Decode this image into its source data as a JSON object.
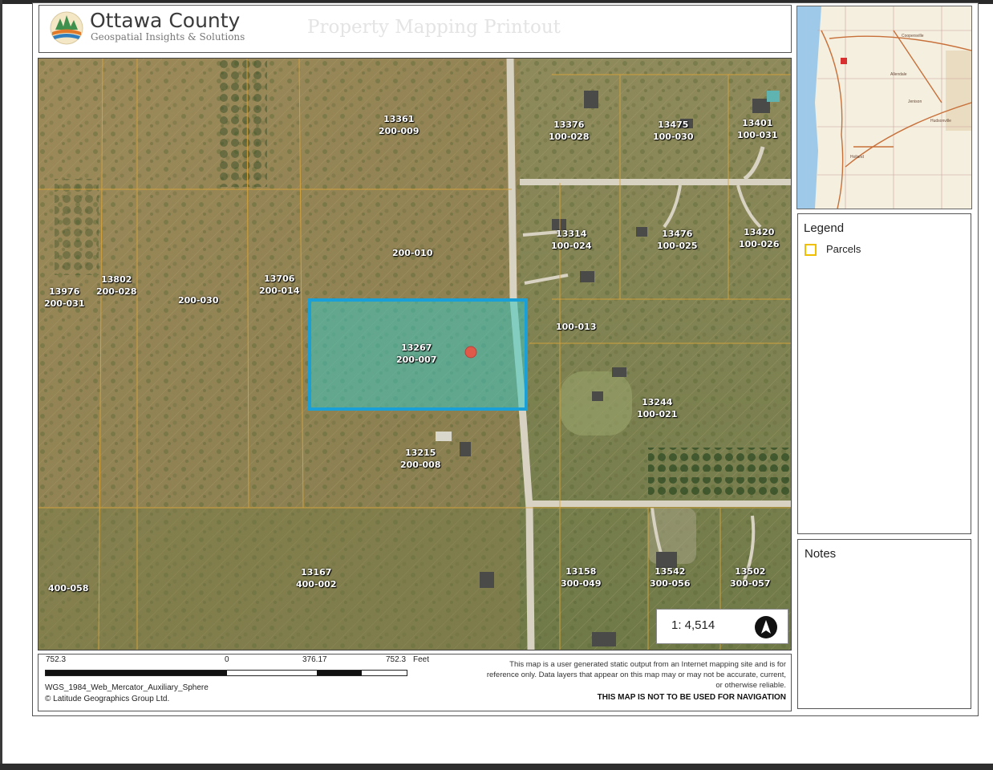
{
  "header": {
    "org_name": "Ottawa County",
    "org_tagline": "Geospatial Insights & Solutions",
    "doc_title": "Property Mapping Printout"
  },
  "map": {
    "parcels": [
      {
        "number": "13361",
        "id": "200-009"
      },
      {
        "number": "13376",
        "id": "100-028"
      },
      {
        "number": "13475",
        "id": "100-030"
      },
      {
        "number": "13401",
        "id": "100-031"
      },
      {
        "number": "",
        "id": "200-010"
      },
      {
        "number": "13314",
        "id": "100-024"
      },
      {
        "number": "13476",
        "id": "100-025"
      },
      {
        "number": "13420",
        "id": "100-026"
      },
      {
        "number": "13802",
        "id": "200-028"
      },
      {
        "number": "13706",
        "id": "200-014"
      },
      {
        "number": "13976",
        "id": "200-031"
      },
      {
        "number": "",
        "id": "200-030"
      },
      {
        "number": "",
        "id": "100-013"
      },
      {
        "number": "13267",
        "id": "200-007"
      },
      {
        "number": "13244",
        "id": "100-021"
      },
      {
        "number": "13215",
        "id": "200-008"
      },
      {
        "number": "",
        "id": "400-058"
      },
      {
        "number": "13167",
        "id": "400-002"
      },
      {
        "number": "13158",
        "id": "300-049"
      },
      {
        "number": "13542",
        "id": "300-056"
      },
      {
        "number": "13502",
        "id": "300-057"
      }
    ],
    "scale_ratio": "1: 4,514",
    "colors": {
      "selected_outline": "#1aa0d6",
      "selected_fill": "#3ec6c0",
      "parcel_line": "#d8a43a",
      "road": "#d8d2c2"
    }
  },
  "inset_map": {
    "labels": [
      "Jenison",
      "Allendale",
      "Hudsonville",
      "Coopersville",
      "Holland"
    ]
  },
  "legend": {
    "title": "Legend",
    "items": [
      {
        "label": "Parcels",
        "color": "#f0c000"
      }
    ]
  },
  "notes": {
    "title": "Notes"
  },
  "footer": {
    "scalebar": {
      "left": "752.3",
      "zero": "0",
      "mid": "376.17",
      "right": "752.3",
      "unit": "Feet"
    },
    "projection": "WGS_1984_Web_Mercator_Auxiliary_Sphere",
    "copyright": "© Latitude Geographics Group Ltd.",
    "disclaimer": "This map is a user generated static output from an Internet mapping site and is for reference only. Data layers that appear on this map may or may not be accurate, current, or otherwise reliable.",
    "warning": "THIS MAP IS NOT TO BE USED FOR NAVIGATION"
  }
}
